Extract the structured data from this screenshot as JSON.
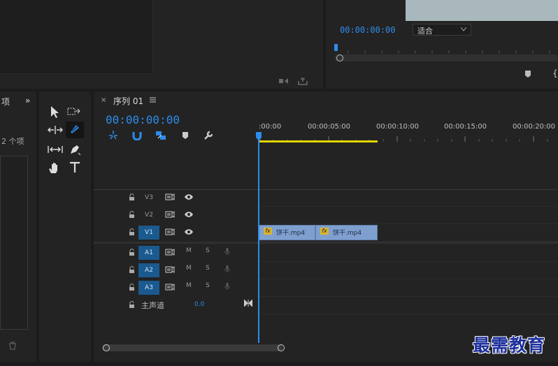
{
  "source_monitor": {
    "icons": [
      "insert-icon",
      "overwrite-icon"
    ]
  },
  "program_monitor": {
    "timecode": "00:00:00:00",
    "zoom_value": "适合"
  },
  "project_panel": {
    "title_fragment": "项",
    "item_count": "2 个项"
  },
  "sequence": {
    "tab_name": "序列 01",
    "timecode": "00:00:00:00",
    "ruler_ticks": [
      ":00:00",
      "00:00:05:00",
      "00:00:10:00",
      "00:00:15:00",
      "00:00:20:00"
    ],
    "video_tracks": [
      {
        "name": "V3",
        "targeted": false
      },
      {
        "name": "V2",
        "targeted": false
      },
      {
        "name": "V1",
        "targeted": true
      }
    ],
    "audio_tracks": [
      {
        "name": "A1",
        "mute": "M",
        "solo": "S"
      },
      {
        "name": "A2",
        "mute": "M",
        "solo": "S"
      },
      {
        "name": "A3",
        "mute": "M",
        "solo": "S"
      }
    ],
    "master": {
      "label": "主声道",
      "value": "0.0"
    },
    "clips": [
      {
        "name": "饼干.mp4",
        "fx": "fx"
      },
      {
        "name": "饼干.mp4",
        "fx": "fx"
      }
    ]
  },
  "colors": {
    "accent": "#2d8ceb",
    "clip": "#7f9fcf",
    "work_area": "#e4d500",
    "track_target": "#1a5a8e"
  },
  "watermark": "最需教育"
}
